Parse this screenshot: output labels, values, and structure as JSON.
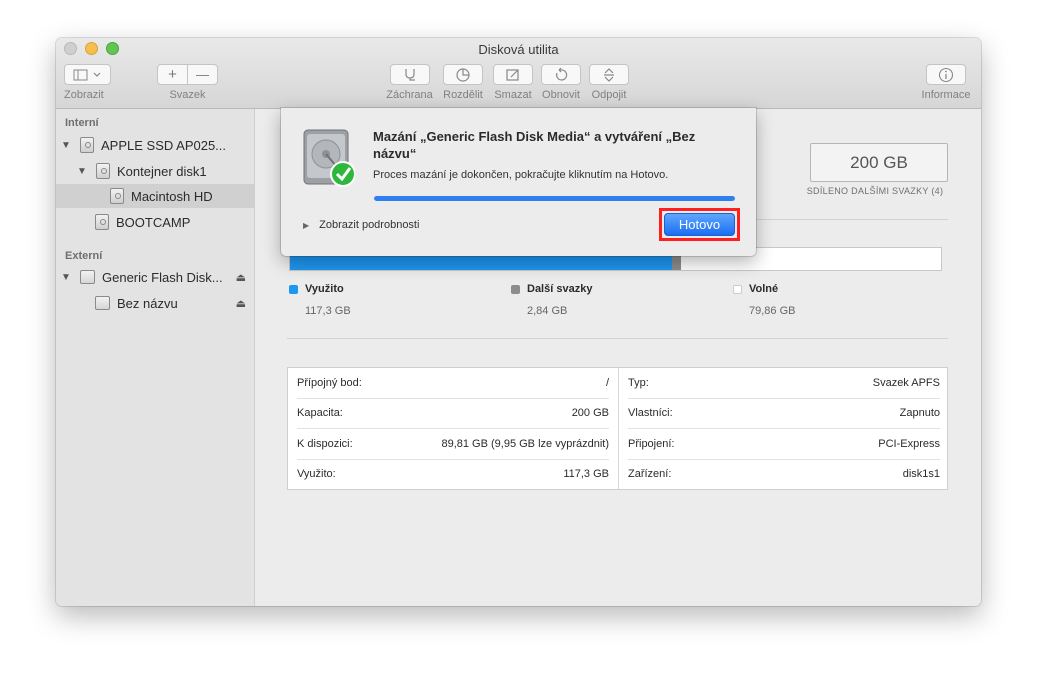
{
  "window": {
    "title": "Disková utilita"
  },
  "toolbar": {
    "view_label": "Zobrazit",
    "volume_label": "Svazek",
    "add_symbol": "+",
    "remove_symbol": "—",
    "first_aid_label": "Záchrana",
    "partition_label": "Rozdělit",
    "erase_label": "Smazat",
    "restore_label": "Obnovit",
    "unmount_label": "Odpojit",
    "info_label": "Informace"
  },
  "sidebar": {
    "internal_header": "Interní",
    "external_header": "Externí",
    "items": [
      {
        "label": "APPLE SSD AP025..."
      },
      {
        "label": "Kontejner disk1"
      },
      {
        "label": "Macintosh HD"
      },
      {
        "label": "BOOTCAMP"
      },
      {
        "label": "Generic Flash Disk..."
      },
      {
        "label": "Bez názvu"
      }
    ]
  },
  "main": {
    "capacity": "200 GB",
    "capacity_note": "SDÍLENO DALŠÍMI SVAZKY (4)",
    "usage": {
      "used_fraction": 0.587,
      "other_fraction": 0.014,
      "legend": [
        {
          "name": "Využito",
          "value": "117,3 GB",
          "color": "#1e97f1"
        },
        {
          "name": "Další svazky",
          "value": "2,84 GB",
          "color": "#8d8d8d"
        },
        {
          "name": "Volné",
          "value": "79,86 GB",
          "color": "#ffffff"
        }
      ]
    },
    "info_left": [
      {
        "label": "Přípojný bod:",
        "value": "/"
      },
      {
        "label": "Kapacita:",
        "value": "200 GB"
      },
      {
        "label": "K dispozici:",
        "value": "89,81 GB (9,95 GB lze vyprázdnit)"
      },
      {
        "label": "Využito:",
        "value": "117,3 GB"
      }
    ],
    "info_right": [
      {
        "label": "Typ:",
        "value": "Svazek APFS"
      },
      {
        "label": "Vlastníci:",
        "value": "Zapnuto"
      },
      {
        "label": "Připojení:",
        "value": "PCI-Express"
      },
      {
        "label": "Zařízení:",
        "value": "disk1s1"
      }
    ]
  },
  "dialog": {
    "title": "Mazání „Generic Flash Disk Media“ a vytváření „Bez názvu“",
    "message": "Proces mazání je dokončen, pokračujte kliknutím na Hotovo.",
    "progress": 1.0,
    "details_label": "Zobrazit podrobnosti",
    "done_label": "Hotovo",
    "highlight_color": "#ff1f1f"
  }
}
